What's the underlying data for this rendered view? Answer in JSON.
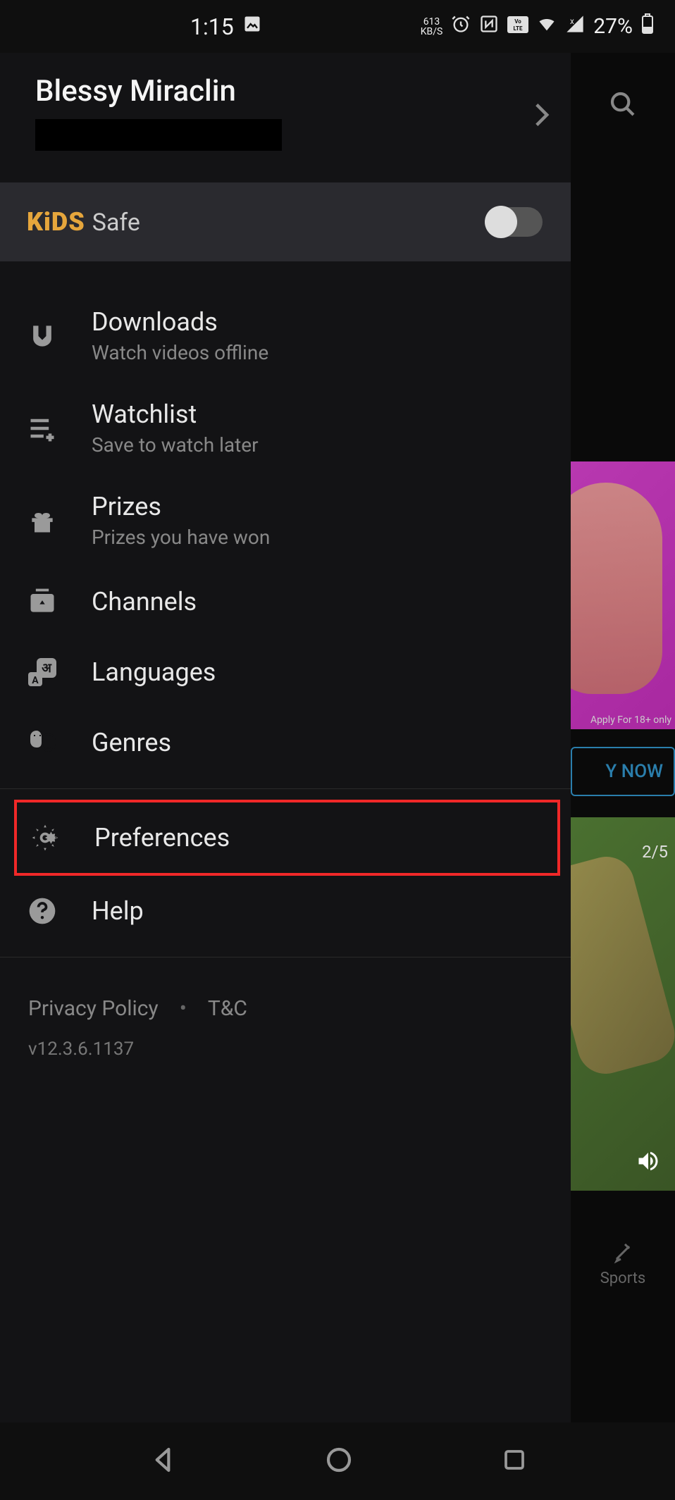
{
  "status_bar": {
    "time": "1:15",
    "kbs_value": "613",
    "kbs_label": "KB/S",
    "battery": "27%"
  },
  "profile": {
    "name": "Blessy Miraclin"
  },
  "kids_safe": {
    "logo": "KiDS",
    "label": "Safe"
  },
  "menu": {
    "downloads": {
      "title": "Downloads",
      "subtitle": "Watch videos offline"
    },
    "watchlist": {
      "title": "Watchlist",
      "subtitle": "Save to watch later"
    },
    "prizes": {
      "title": "Prizes",
      "subtitle": "Prizes you have won"
    },
    "channels": {
      "title": "Channels"
    },
    "languages": {
      "title": "Languages"
    },
    "genres": {
      "title": "Genres"
    },
    "preferences": {
      "title": "Preferences"
    },
    "help": {
      "title": "Help"
    }
  },
  "footer": {
    "privacy": "Privacy Policy",
    "terms": "T&C",
    "version": "v12.3.6.1137"
  },
  "right": {
    "apply_text": "Apply For 18+ only",
    "play_now": "Y NOW",
    "count": "2/5",
    "sports": "Sports"
  }
}
